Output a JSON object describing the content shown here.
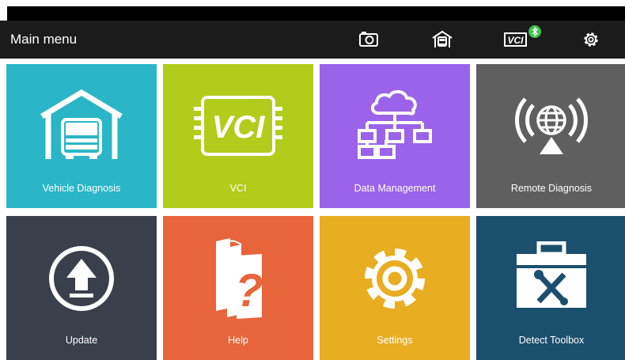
{
  "header": {
    "title": "Main menu",
    "icons": [
      "camera-icon",
      "garage-icon",
      "vci-bluetooth-icon",
      "settings-gear-icon"
    ],
    "vci_badge_text": "VCI"
  },
  "tiles": [
    {
      "label": "Vehicle Diagnosis",
      "color": "#2ab6c6",
      "icon": "truck-garage-icon"
    },
    {
      "label": "VCI",
      "color": "#b1cc1b",
      "icon": "vci-chip-icon"
    },
    {
      "label": "Data Management",
      "color": "#9a63e9",
      "icon": "cloud-network-icon"
    },
    {
      "label": "Remote Diagnosis",
      "color": "#5f5f5f",
      "icon": "globe-broadcast-icon"
    },
    {
      "label": "Update",
      "color": "#3a3f4c",
      "icon": "upload-arrow-icon"
    },
    {
      "label": "Help",
      "color": "#e8643a",
      "icon": "help-books-icon"
    },
    {
      "label": "Settings",
      "color": "#e9ad22",
      "icon": "gear-icon"
    },
    {
      "label": "Detect Toolbox",
      "color": "#1b4f6e",
      "icon": "toolbox-icon"
    }
  ],
  "colors": {
    "bluetooth_badge": "#3ec24a",
    "title_bar": "#1b1b1b"
  }
}
